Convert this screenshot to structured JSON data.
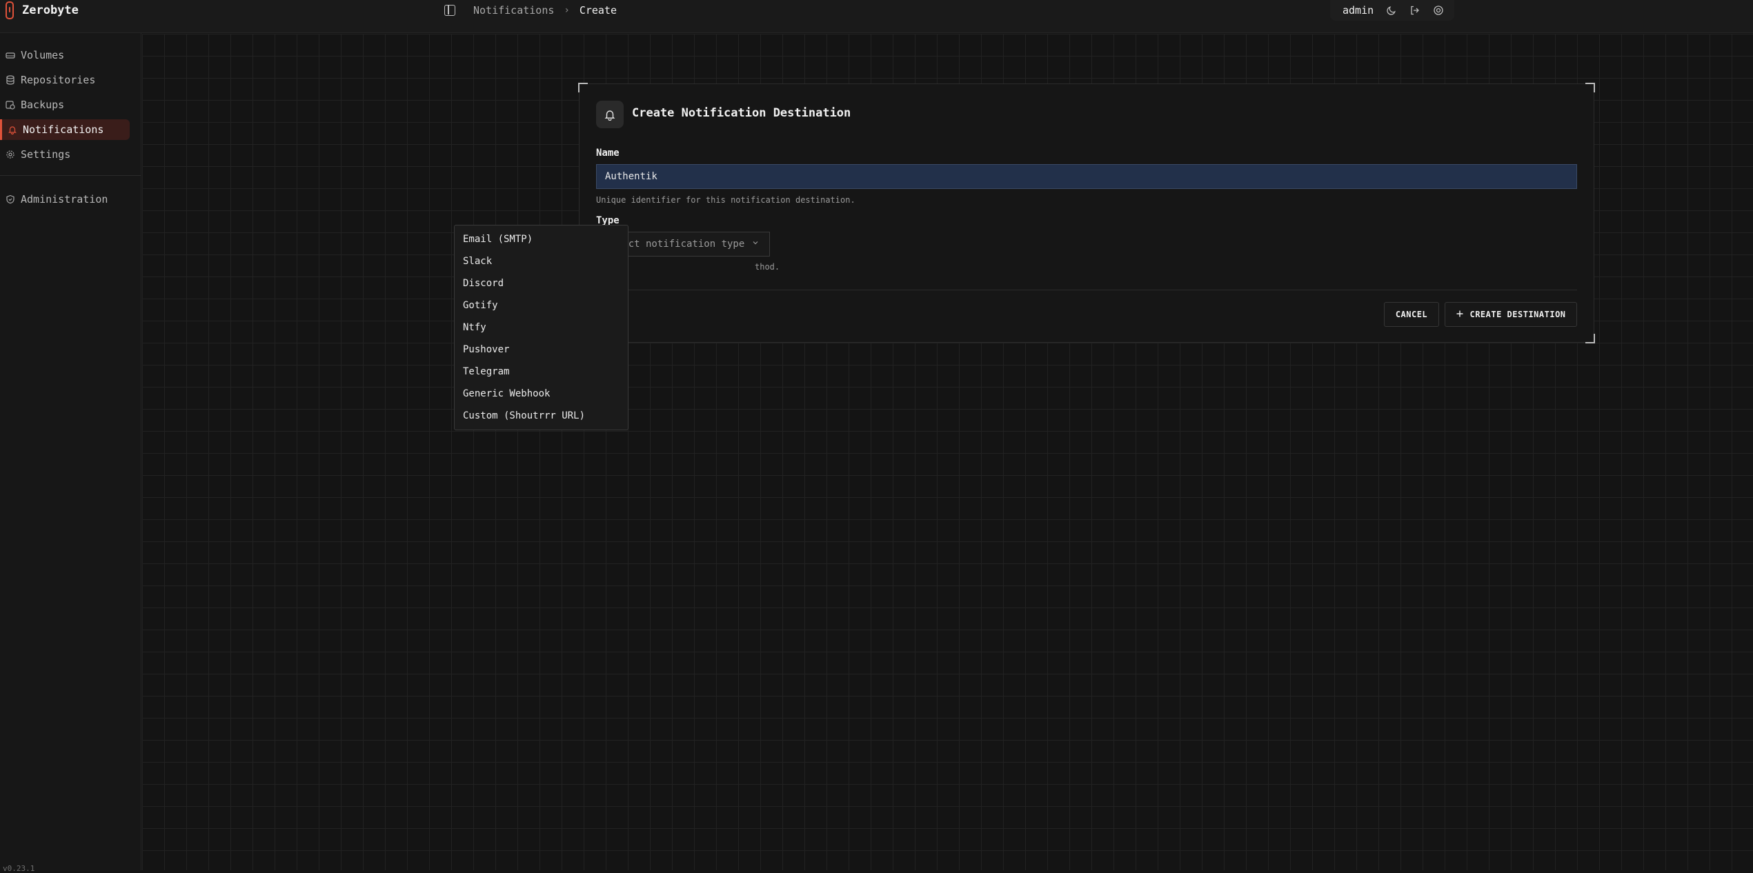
{
  "app": {
    "name": "Zerobyte",
    "version": "v0.23.1"
  },
  "breadcrumb": {
    "parent": "Notifications",
    "separator": "›",
    "current": "Create"
  },
  "header": {
    "user": "admin"
  },
  "sidebar": {
    "items": [
      {
        "label": "Volumes",
        "icon": "hard-drive-icon"
      },
      {
        "label": "Repositories",
        "icon": "database-icon"
      },
      {
        "label": "Backups",
        "icon": "calendar-clock-icon"
      },
      {
        "label": "Notifications",
        "icon": "bell-icon",
        "active": true
      },
      {
        "label": "Settings",
        "icon": "gear-icon"
      },
      {
        "label": "Administration",
        "icon": "shield-icon"
      }
    ]
  },
  "form": {
    "title": "Create Notification Destination",
    "name_label": "Name",
    "name_value": "Authentik",
    "name_help": "Unique identifier for this notification destination.",
    "type_label": "Type",
    "type_placeholder": "Select notification type",
    "type_help_visible": "thod.",
    "cancel_label": "CANCEL",
    "create_label": "CREATE DESTINATION"
  },
  "type_options": [
    "Email (SMTP)",
    "Slack",
    "Discord",
    "Gotify",
    "Ntfy",
    "Pushover",
    "Telegram",
    "Generic Webhook",
    "Custom (Shoutrrr URL)"
  ],
  "colors": {
    "accent": "#e0523a",
    "background": "#141414",
    "input_highlight": "#22304a"
  }
}
